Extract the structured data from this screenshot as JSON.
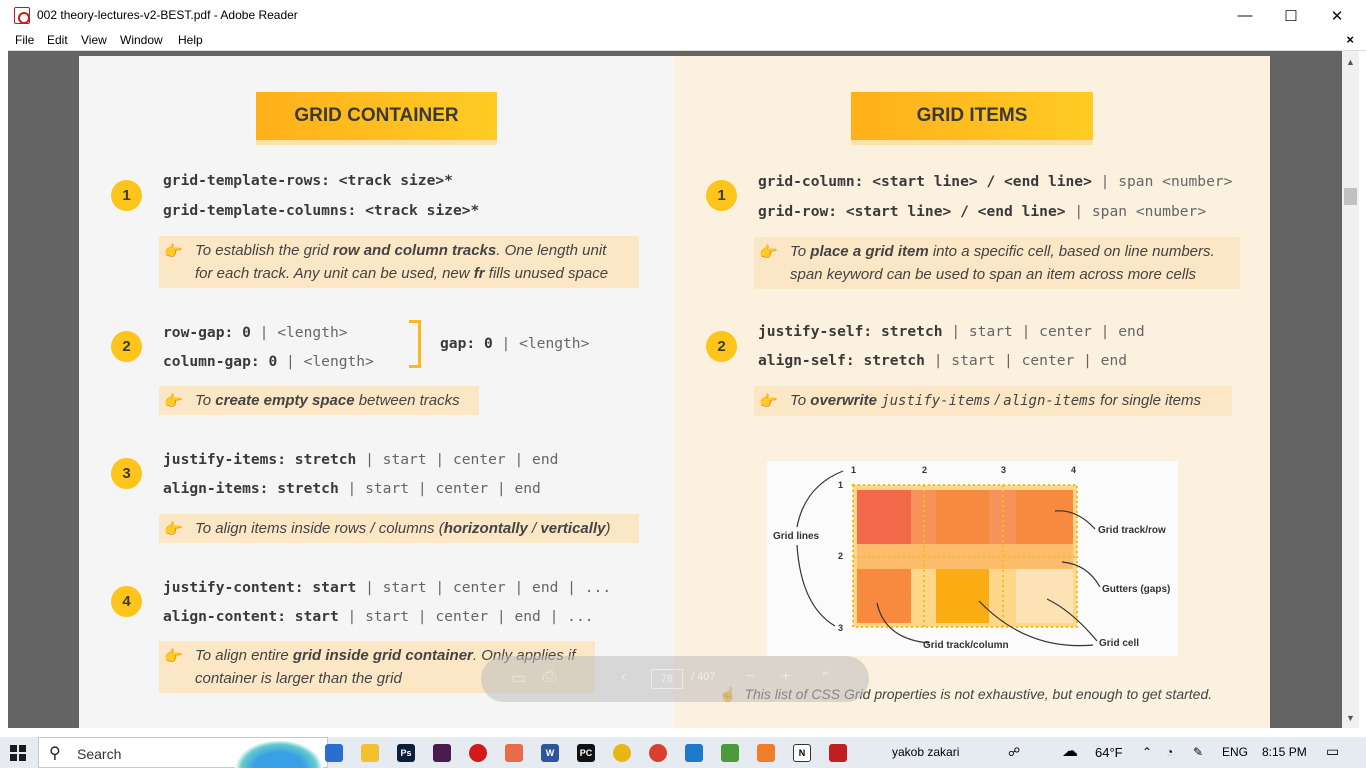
{
  "window": {
    "title": "002 theory-lectures-v2-BEST.pdf - Adobe Reader",
    "controls": [
      "—",
      "☐",
      "✕"
    ]
  },
  "menu": [
    "File",
    "Edit",
    "View",
    "Window",
    "Help"
  ],
  "menu_close": "×",
  "left": {
    "banner": "GRID CONTAINER",
    "s1": {
      "num": "1",
      "line1": "grid-template-rows: <track size>*",
      "line2": "grid-template-columns: <track size>*",
      "note_a": "To establish the grid ",
      "note_b": "row and column tracks",
      "note_c": ". One length unit",
      "note_d": "for each track. Any unit can be used, new ",
      "note_e": "fr",
      "note_f": " fills unused space"
    },
    "s2": {
      "num": "2",
      "l1_key": "row-gap: ",
      "l1_val": "0",
      "l1_rest": " | <length>",
      "l2_key": "column-gap: ",
      "l2_val": "0",
      "l2_rest": " | <length>",
      "gap_key": "gap: ",
      "gap_val": "0",
      "gap_rest": " | <length>",
      "note_a": "To ",
      "note_b": "create empty space",
      "note_c": " between tracks"
    },
    "s3": {
      "num": "3",
      "l1_key": "justify-items: ",
      "l1_val": "stretch",
      "l1_rest": " | start | center | end",
      "l2_key": "align-items: ",
      "l2_val": "stretch",
      "l2_rest": " | start | center | end",
      "note_a": "To align items inside rows / columns (",
      "note_b": "horizontally",
      "note_c": " / ",
      "note_d": "vertically",
      "note_e": ")"
    },
    "s4": {
      "num": "4",
      "l1_key": "justify-content: ",
      "l1_val": "start",
      "l1_rest": " | start | center | end | ...",
      "l2_key": "align-content: ",
      "l2_val": "start",
      "l2_rest": " | start | center | end | ...",
      "note_a": "To align entire ",
      "note_b": "grid inside grid container",
      "note_c": ". Only applies if",
      "note_d": "container is larger than the grid"
    }
  },
  "right": {
    "banner": "GRID ITEMS",
    "s1": {
      "num": "1",
      "l1_key": "grid-column: <start line> / <end line>",
      "l1_rest": " | span <number>",
      "l2_key": "grid-row: <start line> / <end line>",
      "l2_rest": " | span <number>",
      "note_a": "To ",
      "note_b": "place a grid item",
      "note_c": " into a specific cell, based on line numbers.",
      "note_d": "span keyword can be used to span an item across more cells"
    },
    "s2": {
      "num": "2",
      "l1_key": "justify-self: ",
      "l1_val": "stretch",
      "l1_rest": " | start | center | end",
      "l2_key": "align-self: ",
      "l2_val": "stretch",
      "l2_rest": " | start | center | end",
      "note_a": "To ",
      "note_b": "overwrite",
      "note_c": "justify-items",
      "note_d": " / ",
      "note_e": "align-items",
      "note_f": " for single items"
    },
    "diagram": {
      "col_numbers": [
        "1",
        "2",
        "3",
        "4"
      ],
      "row_numbers": [
        "1",
        "2",
        "3"
      ],
      "labels": {
        "grid_lines": "Grid lines",
        "track_row": "Grid track/row",
        "gutters": "Gutters (gaps)",
        "cell": "Grid cell",
        "track_column": "Grid track/column"
      }
    },
    "footnote": "This list of CSS Grid properties is not exhaustive, but enough to get started."
  },
  "nav_toolbar": {
    "page": "78",
    "total": "/ 407"
  },
  "taskbar": {
    "search_placeholder": "Search",
    "user": "yakob zakari",
    "weather": "64°F",
    "lang": "ENG",
    "time": "8:15 PM"
  },
  "colors": {
    "accent": "#fdc51c",
    "note_bg": "#fbe6c6",
    "right_bg": "#fcf0de",
    "left_bg": "#f5f5f5"
  }
}
